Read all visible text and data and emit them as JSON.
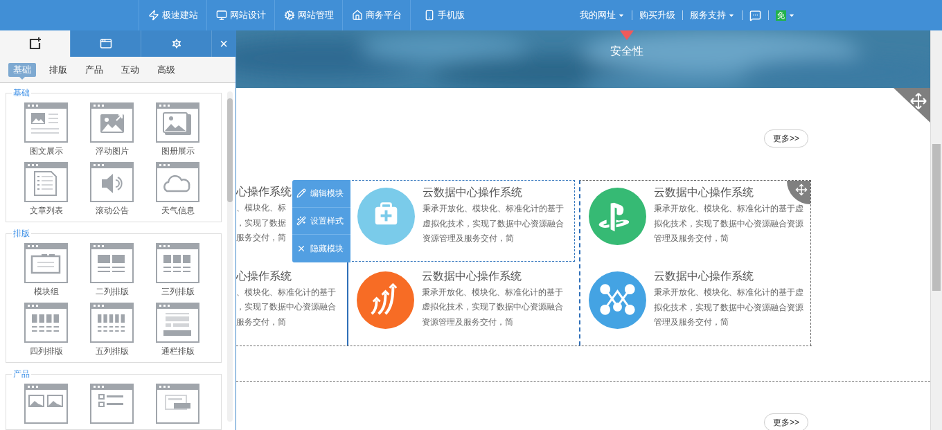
{
  "top_nav": {
    "items": [
      {
        "label": "极速建站",
        "kind": "bolt"
      },
      {
        "label": "网站设计",
        "kind": "monitor"
      },
      {
        "label": "网站管理",
        "kind": "gear"
      },
      {
        "label": "商务平台",
        "kind": "home"
      },
      {
        "label": "手机版",
        "kind": "phone"
      }
    ],
    "links": [
      {
        "label": "我的网址",
        "dropdown": true
      },
      {
        "label": "购买升级",
        "dropdown": false
      },
      {
        "label": "服务支持",
        "dropdown": true
      }
    ],
    "badge": "免"
  },
  "sidebar": {
    "tabs": [
      {
        "kind": "add",
        "selected": true
      },
      {
        "kind": "window",
        "selected": false
      },
      {
        "kind": "settings",
        "selected": false
      }
    ],
    "close": "×",
    "subtabs": [
      {
        "label": "基础",
        "selected": true
      },
      {
        "label": "排版",
        "selected": false
      },
      {
        "label": "产品",
        "selected": false
      },
      {
        "label": "互动",
        "selected": false
      },
      {
        "label": "高级",
        "selected": false
      }
    ],
    "groups": [
      {
        "title": "基础",
        "items": [
          {
            "label": "图文展示",
            "kind": "image-text"
          },
          {
            "label": "浮动图片",
            "kind": "float-image"
          },
          {
            "label": "图册展示",
            "kind": "album"
          },
          {
            "label": "文章列表",
            "kind": "article-list"
          },
          {
            "label": "滚动公告",
            "kind": "marquee"
          },
          {
            "label": "天气信息",
            "kind": "weather"
          }
        ]
      },
      {
        "title": "排版",
        "items": [
          {
            "label": "模块组",
            "kind": "module-group"
          },
          {
            "label": "二列排版",
            "kind": "two-col"
          },
          {
            "label": "三列排版",
            "kind": "three-col"
          },
          {
            "label": "四列排版",
            "kind": "four-col"
          },
          {
            "label": "五列排版",
            "kind": "five-col"
          },
          {
            "label": "通栏排版",
            "kind": "banner-layout"
          }
        ]
      },
      {
        "title": "产品",
        "items": [
          {
            "kind": "product-images"
          },
          {
            "kind": "product-list"
          },
          {
            "kind": "product-detail"
          }
        ]
      }
    ]
  },
  "banner": {
    "caption": "安全性"
  },
  "more_buttons": [
    "更多>>",
    "更多>>"
  ],
  "module_menu": [
    {
      "label": "编辑模块",
      "kind": "pencil"
    },
    {
      "label": "设置样式",
      "kind": "wand"
    },
    {
      "label": "隐藏模块",
      "kind": "close"
    }
  ],
  "card_columns": [
    {
      "selected": false,
      "cards": [
        {
          "title": "心操作系统",
          "lines": [
            "、模块化、标",
            "，实现了数据",
            "服务交付，简"
          ]
        },
        {
          "title": "心操作系统",
          "lines": [
            "、模块化、标准化计的基于",
            "，实现了数据中心资源融合",
            "服务交付，简"
          ]
        }
      ]
    },
    {
      "selected": false,
      "cards": [
        {
          "kind": "medkit",
          "color": "#7acbea",
          "title": "云数据中心操作系统",
          "lines": [
            "秉承开放化、模块化、标准化计的基于",
            "虚拟化技术，实现了数据中心资源融合",
            "资源管理及服务交付，简"
          ],
          "selected": true
        },
        {
          "kind": "arrows",
          "color": "#f76c25",
          "title": "云数据中心操作系统",
          "lines": [
            "秉承开放化、模块化、标准化计的基于",
            "虚拟化技术，实现了数据中心资源融合",
            "资源管理及服务交付，简"
          ],
          "selected": false
        }
      ]
    },
    {
      "selected": true,
      "cards": [
        {
          "kind": "symbol",
          "color": "#36ba74",
          "title": "云数据中心操作系统",
          "lines": [
            "秉承开放化、模块化、标准化计的基于虚",
            "拟化技术，实现了数据中心资源融合资源",
            "管理及服务交付，简"
          ],
          "selected": false
        },
        {
          "kind": "network",
          "color": "#44a3e3",
          "title": "云数据中心操作系统",
          "lines": [
            "秉承开放化、模块化、标准化计的基于虚",
            "拟化技术，实现了数据中心资源融合资源",
            "管理及服务交付，简"
          ],
          "selected": false
        }
      ]
    }
  ]
}
